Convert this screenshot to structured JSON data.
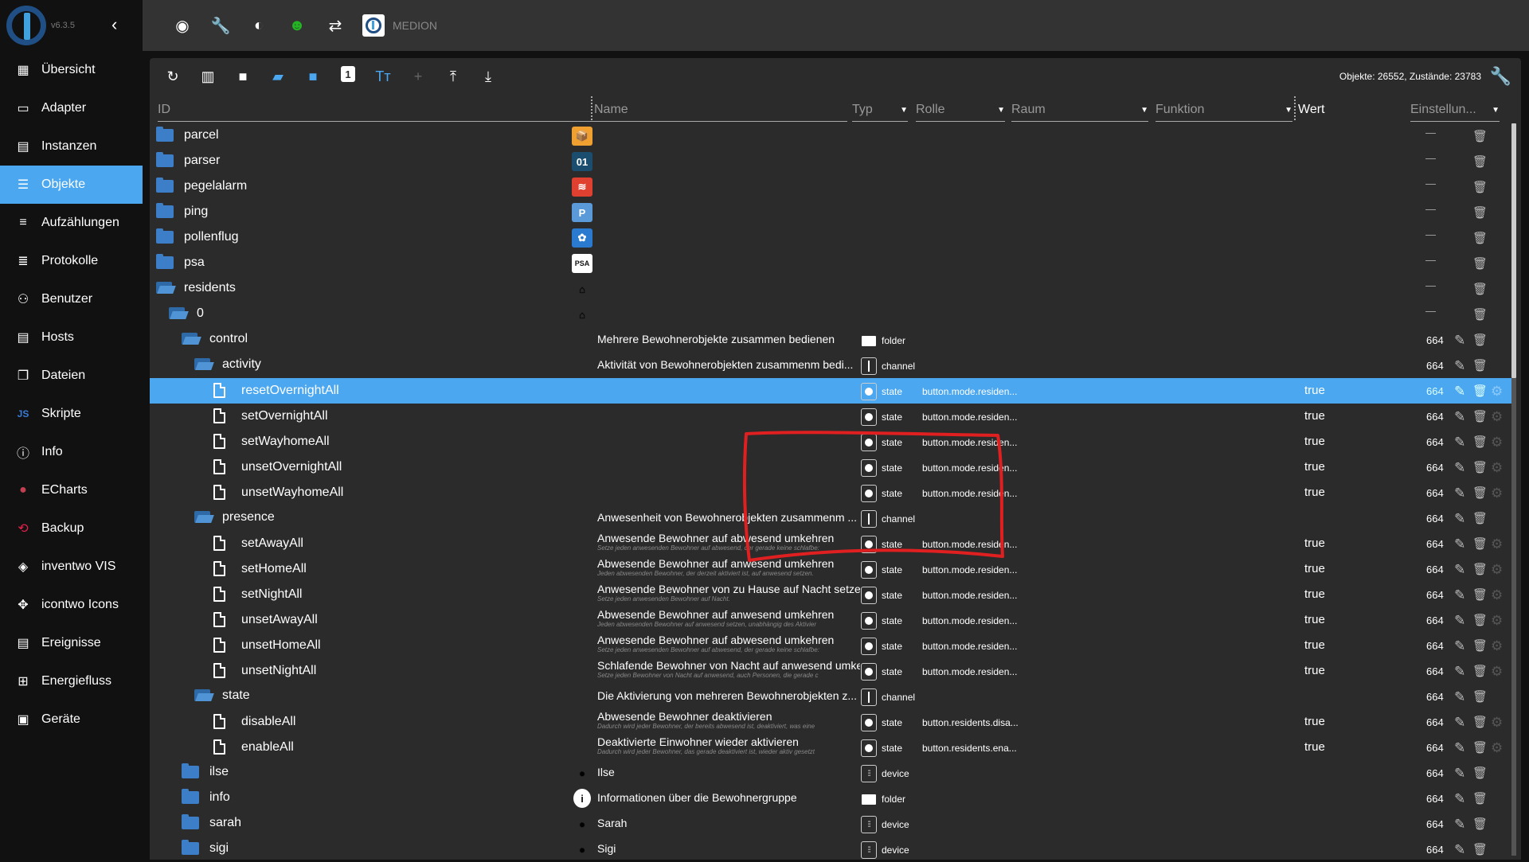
{
  "sidebar": {
    "version": "v6.3.5",
    "collapse_icon": "chevron-left-icon",
    "items": [
      {
        "label": "Übersicht",
        "icon": "grid-icon",
        "glyph": "▦",
        "active": false
      },
      {
        "label": "Adapter",
        "icon": "store-icon",
        "glyph": "▭",
        "active": false
      },
      {
        "label": "Instanzen",
        "icon": "instances-icon",
        "glyph": "▤",
        "active": false
      },
      {
        "label": "Objekte",
        "icon": "list-icon",
        "glyph": "☰",
        "active": true
      },
      {
        "label": "Aufzählungen",
        "icon": "enum-icon",
        "glyph": "≡",
        "active": false
      },
      {
        "label": "Protokolle",
        "icon": "log-icon",
        "glyph": "≣",
        "active": false
      },
      {
        "label": "Benutzer",
        "icon": "user-icon",
        "glyph": "⚇",
        "active": false
      },
      {
        "label": "Hosts",
        "icon": "hosts-icon",
        "glyph": "▤",
        "active": false
      },
      {
        "label": "Dateien",
        "icon": "files-icon",
        "glyph": "❐",
        "active": false
      },
      {
        "label": "Skripte",
        "icon": "js-icon",
        "glyph": "JS",
        "active": false
      },
      {
        "label": "Info",
        "icon": "info-icon",
        "glyph": "ⓘ",
        "active": false
      },
      {
        "label": "ECharts",
        "icon": "echarts-icon",
        "glyph": "●",
        "active": false
      },
      {
        "label": "Backup",
        "icon": "backup-icon",
        "glyph": "⟲",
        "active": false
      },
      {
        "label": "inventwo VIS",
        "icon": "inventwo-icon",
        "glyph": "◈",
        "active": false
      },
      {
        "label": "icontwo Icons",
        "icon": "icontwo-icon",
        "glyph": "✥",
        "active": false
      },
      {
        "label": "Ereignisse",
        "icon": "events-icon",
        "glyph": "▤",
        "active": false
      },
      {
        "label": "Energiefluss",
        "icon": "energy-icon",
        "glyph": "⊞",
        "active": false
      },
      {
        "label": "Geräte",
        "icon": "devices-icon",
        "glyph": "▣",
        "active": false
      }
    ]
  },
  "topbar": {
    "icons": [
      "eye-icon",
      "wrench-icon",
      "brightness-icon",
      "expert-mode-icon",
      "sync-off-icon"
    ],
    "glyphs": [
      "◉",
      "🔧",
      "◐",
      "☻",
      "⇄"
    ],
    "host": "MEDION"
  },
  "toolbar": {
    "buttons": [
      {
        "name": "refresh-button",
        "glyph": "↻",
        "style": ""
      },
      {
        "name": "columns-button",
        "glyph": "▥",
        "style": ""
      },
      {
        "name": "folder-button",
        "glyph": "■",
        "style": ""
      },
      {
        "name": "expand-all-button",
        "glyph": "▰",
        "style": "blue"
      },
      {
        "name": "collapse-button",
        "glyph": "■",
        "style": "blue"
      },
      {
        "name": "expand-level-button",
        "glyph": "1",
        "style": ""
      },
      {
        "name": "text-size-button",
        "glyph": "Tт",
        "style": "blue"
      },
      {
        "name": "add-button",
        "glyph": "+",
        "style": "grey"
      },
      {
        "name": "upload-button",
        "glyph": "⤒",
        "style": ""
      },
      {
        "name": "download-button",
        "glyph": "⤓",
        "style": ""
      }
    ],
    "stats": "Objekte: 26552, Zustände: 23783"
  },
  "columns": {
    "id": "ID",
    "name": "Name",
    "type": "Typ",
    "role": "Rolle",
    "room": "Raum",
    "function": "Funktion",
    "value": "Wert",
    "settings": "Einstellun..."
  },
  "rows": [
    {
      "id": "parcel",
      "level": 0,
      "kind": "folder-closed",
      "adapter_icon": "parcel-icon",
      "icon_glyph": "📦",
      "icon_bg": "#f0a030",
      "dash": true
    },
    {
      "id": "parser",
      "level": 0,
      "kind": "folder-closed",
      "adapter_icon": "parser-icon",
      "icon_glyph": "01",
      "icon_bg": "#1a4d6e",
      "dash": true
    },
    {
      "id": "pegelalarm",
      "level": 0,
      "kind": "folder-closed",
      "adapter_icon": "pegelalarm-icon",
      "icon_glyph": "≋",
      "icon_bg": "#e04030",
      "dash": true
    },
    {
      "id": "ping",
      "level": 0,
      "kind": "folder-closed",
      "adapter_icon": "ping-icon",
      "icon_glyph": "P",
      "icon_bg": "#5a9ad8",
      "dash": true
    },
    {
      "id": "pollenflug",
      "level": 0,
      "kind": "folder-closed",
      "adapter_icon": "pollenflug-icon",
      "icon_glyph": "✿",
      "icon_bg": "#2a7ad0",
      "dash": true
    },
    {
      "id": "psa",
      "level": 0,
      "kind": "folder-closed",
      "adapter_icon": "psa-icon",
      "icon_glyph": "PSA",
      "icon_bg": "#ffffff",
      "dash": true
    },
    {
      "id": "residents",
      "level": 0,
      "kind": "folder-open",
      "adapter_icon": "residents-icon",
      "icon_glyph": "⌂",
      "icon_bg": "transparent",
      "dash": true
    },
    {
      "id": "0",
      "level": 1,
      "kind": "folder-open",
      "adapter_icon": "residents-icon",
      "icon_glyph": "⌂",
      "icon_bg": "transparent",
      "dash": true
    },
    {
      "id": "control",
      "level": 2,
      "kind": "folder-open",
      "name": "Mehrere Bewohnerobjekte zusammen bedienen",
      "type": "folder",
      "acl": "664"
    },
    {
      "id": "activity",
      "level": 3,
      "kind": "folder-open",
      "name": "Aktivität von Bewohnerobjekten zusammenm bedi...",
      "type": "channel",
      "acl": "664"
    },
    {
      "id": "resetOvernightAll",
      "level": 4,
      "kind": "file",
      "name": "",
      "type": "state",
      "role": "button.mode.residen...",
      "value": "true",
      "acl": "664",
      "selected": true
    },
    {
      "id": "setOvernightAll",
      "level": 4,
      "kind": "file",
      "name": "",
      "type": "state",
      "role": "button.mode.residen...",
      "value": "true",
      "acl": "664"
    },
    {
      "id": "setWayhomeAll",
      "level": 4,
      "kind": "file",
      "name": "",
      "type": "state",
      "role": "button.mode.residen...",
      "value": "true",
      "acl": "664"
    },
    {
      "id": "unsetOvernightAll",
      "level": 4,
      "kind": "file",
      "name": "",
      "type": "state",
      "role": "button.mode.residen...",
      "value": "true",
      "acl": "664"
    },
    {
      "id": "unsetWayhomeAll",
      "level": 4,
      "kind": "file",
      "name": "",
      "type": "state",
      "role": "button.mode.residen...",
      "value": "true",
      "acl": "664"
    },
    {
      "id": "presence",
      "level": 3,
      "kind": "folder-open",
      "name": "Anwesenheit von Bewohnerobjekten zusammenm ...",
      "type": "channel",
      "acl": "664"
    },
    {
      "id": "setAwayAll",
      "level": 4,
      "kind": "file",
      "name": "Anwesende Bewohner auf abwesend umkehren",
      "desc": "Setze jeden anwesenden Bewohner auf abwesend, der gerade keine schlafbe:",
      "type": "state",
      "role": "button.mode.residen...",
      "value": "true",
      "acl": "664"
    },
    {
      "id": "setHomeAll",
      "level": 4,
      "kind": "file",
      "name": "Abwesende Bewohner auf anwesend umkehren",
      "desc": "Jeden abwesenden Bewohner, der derzeit aktiviert ist, auf anwesend setzen.",
      "type": "state",
      "role": "button.mode.residen...",
      "value": "true",
      "acl": "664"
    },
    {
      "id": "setNightAll",
      "level": 4,
      "kind": "file",
      "name": "Anwesende Bewohner von zu Hause auf Nacht setzen",
      "desc": "Setze jeden anwesenden Bewohner auf Nacht.",
      "type": "state",
      "role": "button.mode.residen...",
      "value": "true",
      "acl": "664"
    },
    {
      "id": "unsetAwayAll",
      "level": 4,
      "kind": "file",
      "name": "Abwesende Bewohner auf anwesend umkehren",
      "desc": "Jeden abwesenden Bewohner auf anwesend setzen, unabhängig des Aktivier",
      "type": "state",
      "role": "button.mode.residen...",
      "value": "true",
      "acl": "664"
    },
    {
      "id": "unsetHomeAll",
      "level": 4,
      "kind": "file",
      "name": "Anwesende Bewohner auf abwesend umkehren",
      "desc": "Setze jeden anwesenden Bewohner auf abwesend, der gerade keine schlafbe:",
      "type": "state",
      "role": "button.mode.residen...",
      "value": "true",
      "acl": "664"
    },
    {
      "id": "unsetNightAll",
      "level": 4,
      "kind": "file",
      "name": "Schlafende Bewohner von Nacht auf anwesend umkehren",
      "desc": "Setze jeden Bewohner von Nacht auf anwesend, auch Personen, die gerade c",
      "type": "state",
      "role": "button.mode.residen...",
      "value": "true",
      "acl": "664"
    },
    {
      "id": "state",
      "level": 3,
      "kind": "folder-open",
      "name": "Die Aktivierung von mehreren Bewohnerobjekten z...",
      "type": "channel",
      "acl": "664"
    },
    {
      "id": "disableAll",
      "level": 4,
      "kind": "file",
      "name": "Abwesende Bewohner deaktivieren",
      "desc": "Dadurch wird jeder Bewohner, der bereits abwesend ist, deaktiviert, was eine",
      "type": "state",
      "role": "button.residents.disa...",
      "value": "true",
      "acl": "664"
    },
    {
      "id": "enableAll",
      "level": 4,
      "kind": "file",
      "name": "Deaktivierte Einwohner wieder aktivieren",
      "desc": "Dadurch wird jeder Bewohner, das gerade deaktiviert ist, wieder aktiv gesetzt",
      "type": "state",
      "role": "button.residents.ena...",
      "value": "true",
      "acl": "664"
    },
    {
      "id": "ilse",
      "level": 2,
      "kind": "folder-closed",
      "name": "Ilse",
      "type": "device",
      "acl": "664",
      "adapter_icon": "person-icon",
      "icon_glyph": "●",
      "icon_bg": "transparent"
    },
    {
      "id": "info",
      "level": 2,
      "kind": "folder-closed",
      "name": "Informationen über die Bewohnergruppe",
      "type": "folder",
      "acl": "664",
      "adapter_icon": "info-icon",
      "icon_glyph": "i",
      "icon_bg": "#ffffff"
    },
    {
      "id": "sarah",
      "level": 2,
      "kind": "folder-closed",
      "name": "Sarah",
      "type": "device",
      "acl": "664",
      "adapter_icon": "person-icon",
      "icon_glyph": "●",
      "icon_bg": "transparent"
    },
    {
      "id": "sigi",
      "level": 2,
      "kind": "folder-closed",
      "name": "Sigi",
      "type": "device",
      "acl": "664",
      "adapter_icon": "person-icon",
      "icon_glyph": "●",
      "icon_bg": "transparent"
    }
  ],
  "colors": {
    "accent": "#4aa7f0",
    "annotation": "#e02020"
  }
}
